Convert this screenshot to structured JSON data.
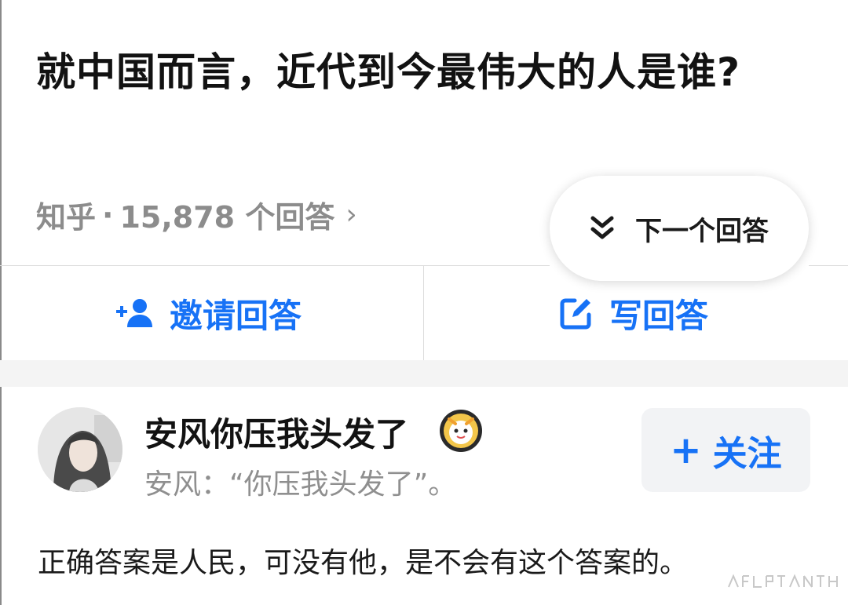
{
  "question": {
    "title": "就中国而言，近代到今最伟大的人是谁?"
  },
  "meta": {
    "source": "知乎",
    "separator": "·",
    "answer_count": "15,878 个回答",
    "chevron": "›"
  },
  "next_button": {
    "label": "下一个回答"
  },
  "actions": {
    "invite_label": "邀请回答",
    "write_label": "写回答"
  },
  "author": {
    "name": "安风你压我头发了",
    "bio": "安风：“你压我头发了”。",
    "follow_label": "关注",
    "follow_plus": "+"
  },
  "answer": {
    "text": "正确答案是人民，可没有他，是不会有这个答案的。"
  },
  "colors": {
    "accent": "#1772f6",
    "text": "#121212",
    "muted": "#8c8c8c"
  }
}
